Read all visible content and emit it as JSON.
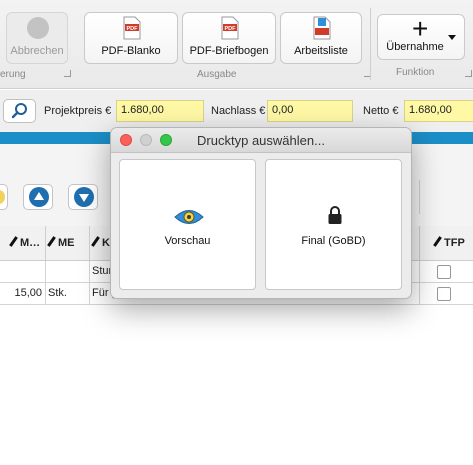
{
  "ribbon": {
    "cancel_label": "Abbrechen",
    "group_left_fragment": "erung",
    "pdf_blank_label": "PDF-Blanko",
    "pdf_letterhead_label": "PDF-Briefbogen",
    "worklist_label": "Arbeitsliste",
    "group_output_label": "Ausgabe",
    "take_over_label": "Übernahme",
    "group_function_label": "Funktion",
    "pdf_badge": "PDF"
  },
  "fields": {
    "project_price_label": "Projektpreis €",
    "project_price_value": "1.680,00",
    "discount_label": "Nachlass €",
    "discount_value": "0,00",
    "net_label": "Netto €",
    "net_value": "1.680,00"
  },
  "grid": {
    "headers": {
      "m": "M…",
      "me": "ME",
      "k": "K",
      "tfp": "TFP"
    },
    "rows": [
      {
        "m": "",
        "me": "",
        "text": "Stun"
      },
      {
        "m": "15,00",
        "me": "Stk.",
        "text": "Für g"
      }
    ]
  },
  "dialog": {
    "title": "Drucktyp auswählen...",
    "preview_label": "Vorschau",
    "final_label": "Final (GoBD)"
  },
  "colors": {
    "accent_blue": "#1c8ec7",
    "field_yellow": "#fff9a6",
    "close_red": "#fc605b",
    "minimize_gray": "#d0d0d0",
    "zoom_green": "#34c84a"
  }
}
